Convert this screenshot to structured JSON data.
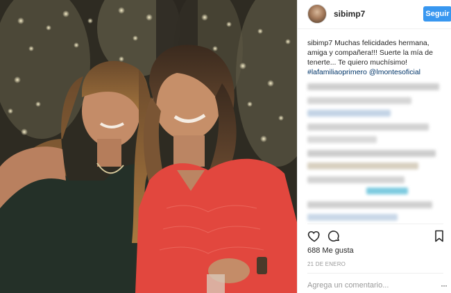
{
  "post": {
    "username": "sibimp7",
    "follow_label": "Seguir",
    "caption": {
      "user": "sibimp7",
      "text": "Muchas felicidades hermana, amiga y compañera!!! Suerte la mía de tenerte... Te quiero muchísimo!",
      "hashtag": "#lafamiliaoprimero",
      "mention": "@lmontesoficial"
    },
    "likes": "688 Me gusta",
    "date": "21 DE ENERO",
    "comment_placeholder": "Agrega un comentario...",
    "more_label": "···"
  },
  "photo": {
    "description_icon": "photo"
  },
  "colors": {
    "accent": "#3897f0",
    "link": "#003569",
    "border": "#efefef",
    "muted": "#999999",
    "dress": "#e2473e"
  },
  "icons": {
    "like": "heart-outline-icon",
    "comment": "comment-bubble-icon",
    "save": "bookmark-outline-icon"
  }
}
